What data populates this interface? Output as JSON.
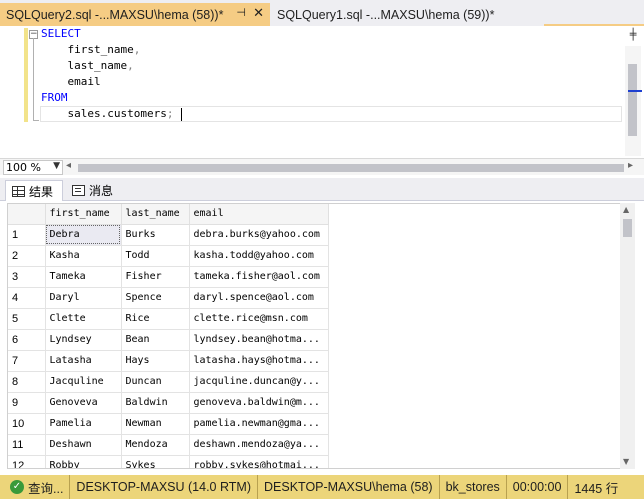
{
  "tabs": [
    {
      "title": "SQLQuery2.sql -...MAXSU\\hema (58))*",
      "pin": "⊣",
      "close": "✕"
    },
    {
      "title": "SQLQuery1.sql -...MAXSU\\hema (59))*"
    }
  ],
  "editor": {
    "lines": [
      {
        "kw": "SELECT",
        "text": ""
      },
      {
        "kw": "",
        "text": "    first_name",
        "punct": ","
      },
      {
        "kw": "",
        "text": "    last_name",
        "punct": ","
      },
      {
        "kw": "",
        "text": "    email",
        "punct": ""
      },
      {
        "kw": "FROM",
        "text": ""
      },
      {
        "kw": "",
        "text": "    sales.customers",
        "punct": ";"
      }
    ]
  },
  "zoom": {
    "value": "100 %"
  },
  "result_tabs": {
    "results": "结果",
    "messages": "消息"
  },
  "grid": {
    "columns": [
      "first_name",
      "last_name",
      "email"
    ],
    "rows": [
      {
        "n": "1",
        "first_name": "Debra",
        "last_name": "Burks",
        "email": "debra.burks@yahoo.com"
      },
      {
        "n": "2",
        "first_name": "Kasha",
        "last_name": "Todd",
        "email": "kasha.todd@yahoo.com"
      },
      {
        "n": "3",
        "first_name": "Tameka",
        "last_name": "Fisher",
        "email": "tameka.fisher@aol.com"
      },
      {
        "n": "4",
        "first_name": "Daryl",
        "last_name": "Spence",
        "email": "daryl.spence@aol.com"
      },
      {
        "n": "5",
        "first_name": "Clette",
        "last_name": "Rice",
        "email": "clette.rice@msn.com"
      },
      {
        "n": "6",
        "first_name": "Lyndsey",
        "last_name": "Bean",
        "email": "lyndsey.bean@hotma..."
      },
      {
        "n": "7",
        "first_name": "Latasha",
        "last_name": "Hays",
        "email": "latasha.hays@hotma..."
      },
      {
        "n": "8",
        "first_name": "Jacquline",
        "last_name": "Duncan",
        "email": "jacquline.duncan@y..."
      },
      {
        "n": "9",
        "first_name": "Genoveva",
        "last_name": "Baldwin",
        "email": "genoveva.baldwin@m..."
      },
      {
        "n": "10",
        "first_name": "Pamelia",
        "last_name": "Newman",
        "email": "pamelia.newman@gma..."
      },
      {
        "n": "11",
        "first_name": "Deshawn",
        "last_name": "Mendoza",
        "email": "deshawn.mendoza@ya..."
      },
      {
        "n": "12",
        "first_name": "Robby",
        "last_name": "Sykes",
        "email": "robby.sykes@hotmai..."
      }
    ]
  },
  "status": {
    "query_state": "查询...",
    "server": "DESKTOP-MAXSU (14.0 RTM)",
    "user": "DESKTOP-MAXSU\\hema (58)",
    "database": "bk_stores",
    "elapsed": "00:00:00",
    "rows": "1445 行",
    "ok_icon": "check-circle-icon"
  },
  "colors": {
    "active_tab": "#f5cc84",
    "status_bar": "#ecd57a",
    "keyword": "#0000ff"
  }
}
